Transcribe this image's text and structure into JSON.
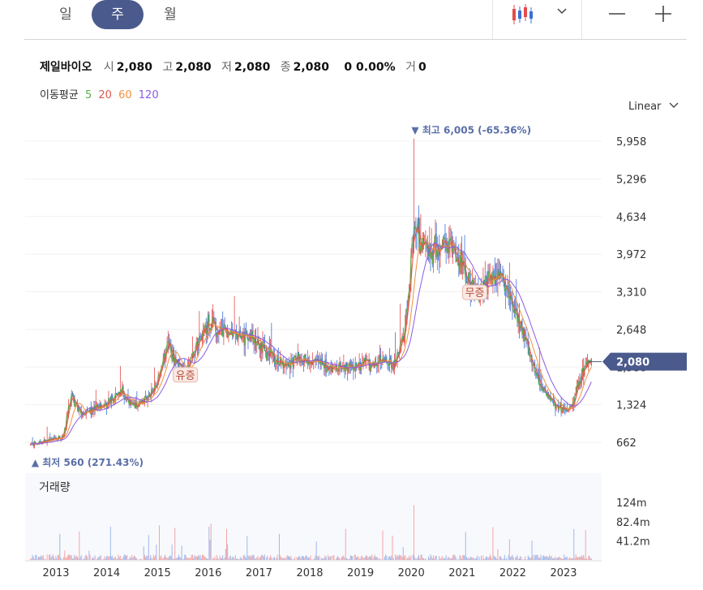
{
  "tabs": [
    {
      "label": "일",
      "active": false
    },
    {
      "label": "주",
      "active": true
    },
    {
      "label": "월",
      "active": false
    }
  ],
  "icons": {
    "chart_type": "candlestick-icon",
    "dropdown": "chevron-down-icon",
    "zoom_out": "minus-icon",
    "zoom_in": "plus-icon"
  },
  "info": {
    "name": "제일바이오",
    "open_label": "시",
    "open": "2,080",
    "high_label": "고",
    "high": "2,080",
    "low_label": "저",
    "low": "2,080",
    "close_label": "종",
    "close": "2,080",
    "change": "0 0.00%",
    "volume_label": "거",
    "volume": "0"
  },
  "ma": {
    "label": "이동평균",
    "items": [
      {
        "period": "5",
        "color": "#5cae4b"
      },
      {
        "period": "20",
        "color": "#e2574c"
      },
      {
        "period": "60",
        "color": "#f0913f"
      },
      {
        "period": "120",
        "color": "#8a5ce6"
      }
    ]
  },
  "scale_label": "Linear",
  "colors": {
    "up": "#e34b4b",
    "down": "#3d6fd6",
    "accent": "#4a5a8c"
  },
  "chart_data": {
    "type": "candlestick",
    "price_axis": {
      "ticks": [
        662,
        1324,
        1986,
        2648,
        3310,
        3972,
        4634,
        5296,
        5958
      ],
      "tick_labels": [
        "662",
        "1,324",
        "1,986",
        "2,648",
        "3,310",
        "3,972",
        "4,634",
        "5,296",
        "5,958"
      ],
      "range": [
        300,
        6300
      ]
    },
    "time_axis": {
      "labels": [
        "2013",
        "2014",
        "2015",
        "2016",
        "2017",
        "2018",
        "2019",
        "2020",
        "2021",
        "2022",
        "2023"
      ]
    },
    "current_price": {
      "label": "2,080",
      "value": 2080
    },
    "max_marker": {
      "label": "▼ 최고 6,005 (-65.36%)",
      "value": 6005,
      "time": 2020.05
    },
    "min_marker": {
      "label": "▲ 최저 560 (271.43%)",
      "value": 560,
      "time": 2012.55
    },
    "events": [
      {
        "label": "유증",
        "time": 2015.55,
        "value": 1850
      },
      {
        "label": "무증",
        "time": 2021.25,
        "value": 3300
      }
    ],
    "price_path": [
      [
        2012.5,
        620
      ],
      [
        2012.9,
        700
      ],
      [
        2013.15,
        760
      ],
      [
        2013.3,
        1500
      ],
      [
        2013.5,
        1150
      ],
      [
        2013.75,
        1250
      ],
      [
        2014.0,
        1350
      ],
      [
        2014.3,
        1550
      ],
      [
        2014.5,
        1300
      ],
      [
        2014.75,
        1400
      ],
      [
        2015.0,
        1700
      ],
      [
        2015.2,
        2400
      ],
      [
        2015.35,
        2100
      ],
      [
        2015.55,
        1850
      ],
      [
        2015.8,
        2450
      ],
      [
        2016.0,
        2750
      ],
      [
        2016.3,
        2600
      ],
      [
        2016.6,
        2500
      ],
      [
        2016.9,
        2500
      ],
      [
        2017.2,
        2200
      ],
      [
        2017.5,
        2000
      ],
      [
        2017.8,
        2150
      ],
      [
        2018.0,
        2100
      ],
      [
        2018.3,
        2000
      ],
      [
        2018.6,
        1950
      ],
      [
        2018.9,
        2000
      ],
      [
        2019.2,
        2050
      ],
      [
        2019.5,
        2150
      ],
      [
        2019.65,
        2000
      ],
      [
        2019.8,
        2300
      ],
      [
        2019.95,
        3200
      ],
      [
        2020.05,
        4500
      ],
      [
        2020.2,
        4200
      ],
      [
        2020.4,
        4000
      ],
      [
        2020.6,
        4200
      ],
      [
        2020.8,
        4100
      ],
      [
        2021.0,
        3800
      ],
      [
        2021.2,
        3400
      ],
      [
        2021.4,
        3300
      ],
      [
        2021.6,
        3600
      ],
      [
        2021.8,
        3500
      ],
      [
        2022.0,
        3100
      ],
      [
        2022.2,
        2600
      ],
      [
        2022.4,
        2000
      ],
      [
        2022.6,
        1600
      ],
      [
        2022.8,
        1350
      ],
      [
        2023.0,
        1250
      ],
      [
        2023.15,
        1300
      ],
      [
        2023.3,
        1700
      ],
      [
        2023.45,
        2000
      ],
      [
        2023.55,
        2080
      ]
    ],
    "volume_panel": {
      "title": "거래량",
      "ticks": [
        41.2,
        82.4,
        124
      ],
      "tick_labels": [
        "41.2m",
        "82.4m",
        "124m"
      ]
    }
  }
}
